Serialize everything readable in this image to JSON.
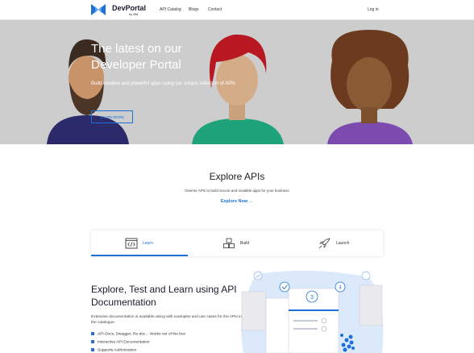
{
  "nav": {
    "brand": "DevPortal",
    "brand_sub": "by BM",
    "links": [
      "API Catalog",
      "Blogs",
      "Contact"
    ],
    "login": "Log in"
  },
  "hero": {
    "title": "The latest on our Developer Portal",
    "subtitle": "Build creative and powerful apps using our unique selection of APIs",
    "button": "LEARN MORE"
  },
  "explore": {
    "title": "Explore APIs",
    "subtitle": "Diverse APIs to build secure and scalable apps for your business",
    "link": "Explore Now →"
  },
  "tabs": [
    {
      "label": "Learn",
      "icon": "code-window-icon",
      "active": true
    },
    {
      "label": "Build",
      "icon": "cubes-icon",
      "active": false
    },
    {
      "label": "Launch",
      "icon": "rocket-icon",
      "active": false
    }
  ],
  "section": {
    "title": "Explore, Test and Learn using API Documentation",
    "description": "Extensive documentation is available along with examples and use cases for the APIs in the catalogue.",
    "features": [
      "API Docs, Swagger, Re-doc, - Works out of the box",
      "Interactive API Documentation",
      "Supports Authorization"
    ]
  },
  "illustration": {
    "step_numbers": [
      "3",
      "4"
    ]
  },
  "colors": {
    "accent": "#1e6fd9",
    "hero_bg": "#cfcfcf"
  }
}
